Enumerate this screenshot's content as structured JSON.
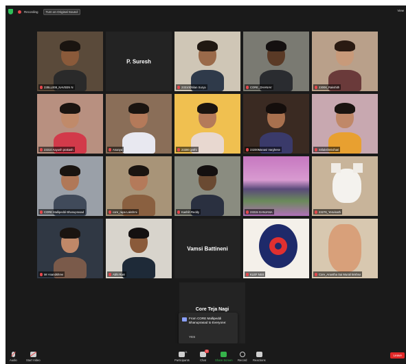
{
  "topbar": {
    "recording_label": "Recording",
    "original_sound_label": "Turn on Original Sound",
    "view_label": "View"
  },
  "tiles": [
    {
      "name": "22BLL008_NAVEEN N",
      "kind": "video",
      "bg": "#5a4a3a",
      "skin": "#8a5a3a",
      "hair": "#1a1410",
      "shirt": "#2a2a2a"
    },
    {
      "name": "",
      "display_name": "P. Suresh",
      "kind": "name",
      "bg": "#232323"
    },
    {
      "name": "23310Dhilan Surya",
      "kind": "video",
      "bg": "#cfc6b6",
      "skin": "#9a6a4a",
      "hair": "#201812",
      "shirt": "#2f3a4a"
    },
    {
      "name": "CORE_DHANAV",
      "kind": "video",
      "bg": "#7a7a72",
      "skin": "#5a3a26",
      "hair": "#141010",
      "shirt": "#2a2c30"
    },
    {
      "name": "23008_Rakshith",
      "kind": "video",
      "bg": "#b9a08a",
      "skin": "#c89a7a",
      "hair": "#2a1a12",
      "shirt": "#6a3a3a"
    },
    {
      "name": "23310 Aayush prakash",
      "kind": "video",
      "bg": "#b89080",
      "skin": "#c08a6a",
      "hair": "#1a1410",
      "shirt": "#d23a4a"
    },
    {
      "name": "Ananya",
      "kind": "video",
      "bg": "#8a6e58",
      "skin": "#b47a5a",
      "hair": "#1a1410",
      "shirt": "#e8e8f0"
    },
    {
      "name": "23300 jyothi",
      "kind": "video",
      "bg": "#f0c050",
      "skin": "#b47a5a",
      "hair": "#1a1410",
      "shirt": "#e8d8d0"
    },
    {
      "name": "23200Manasi Varghese",
      "kind": "video",
      "bg": "#3a2a22",
      "skin": "#a8704e",
      "hair": "#140e0c",
      "shirt": "#3a3a6a",
      "active": true
    },
    {
      "name": "Srilakshmivihari",
      "kind": "video",
      "bg": "#c8a8b0",
      "skin": "#c08868",
      "hair": "#1a1410",
      "shirt": "#e8a030"
    },
    {
      "name": "CORE Mallipeddi Bhanuprasad",
      "kind": "video",
      "bg": "#9aa0a8",
      "skin": "#b07858",
      "hair": "#1a1410",
      "shirt": "#404a5a"
    },
    {
      "name": "core_rapa Lakshmi",
      "kind": "video",
      "bg": "#a89478",
      "skin": "#b47a5a",
      "hair": "#1a1410",
      "shirt": "#8a6040"
    },
    {
      "name": "Kashih Reddy",
      "kind": "video",
      "bg": "#8a8c80",
      "skin": "#6a4a32",
      "hair": "#141010",
      "shirt": "#2a3040"
    },
    {
      "name": "23315 GANJANA",
      "kind": "landscape",
      "bg": "#b070a8"
    },
    {
      "name": "23276_Yesvinath",
      "kind": "kitten",
      "bg": "#c8b49a"
    },
    {
      "name": "Mr Anandshree",
      "kind": "video",
      "bg": "#303844",
      "skin": "#c08868",
      "hair": "#1a1410",
      "shirt": "#7a5a4a"
    },
    {
      "name": "Abhi Ram",
      "kind": "video",
      "bg": "#d8d4cc",
      "skin": "#8a5a3a",
      "hair": "#141010",
      "shirt": "#1e2a38"
    },
    {
      "name": "",
      "display_name": "Vamsi Battineni",
      "kind": "name",
      "bg": "#232323"
    },
    {
      "name": "KLEF NSS",
      "kind": "nss",
      "bg": "#f4f0ea"
    },
    {
      "name": "Core_Anantha Sai Murali krishna",
      "kind": "baby",
      "bg": "#d8c8b0"
    }
  ],
  "partial_tile": {
    "display_name": "Core Teja Nagi"
  },
  "chat_popup": {
    "title": "From CORE Mallipeddi Bhanuprasad to Everyone:",
    "message": "YES"
  },
  "toolbar": {
    "audio_label": "Audio",
    "video_label": "Start Video",
    "participants_label": "Participants",
    "participants_count": "21",
    "chat_label": "Chat",
    "chat_badge": "1",
    "share_label": "Share Screen",
    "record_label": "Record",
    "reactions_label": "Reactions",
    "leave_label": "Leave"
  },
  "colors": {
    "background": "#1a1a1a",
    "tile": "#232323",
    "active_border": "#c9d449",
    "share_green": "#35b34a",
    "leave_red": "#e02828"
  }
}
